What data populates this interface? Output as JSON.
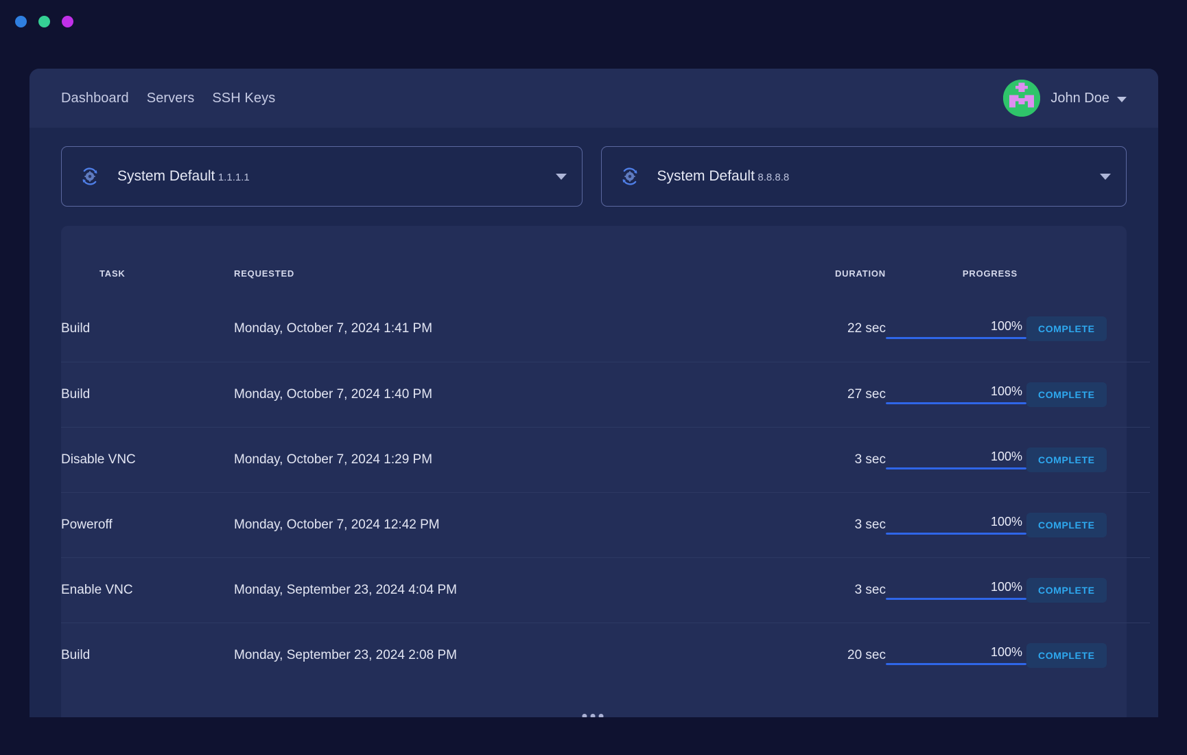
{
  "window": {
    "chrome_dots": [
      {
        "name": "close-dot",
        "color": "#2f7fe0"
      },
      {
        "name": "minimize-dot",
        "color": "#35d094"
      },
      {
        "name": "maximize-dot",
        "color": "#c030e8"
      }
    ]
  },
  "nav": {
    "links": [
      {
        "label": "Dashboard"
      },
      {
        "label": "Servers"
      },
      {
        "label": "SSH Keys"
      }
    ],
    "user": {
      "name": "John Doe",
      "avatar_bg": "#2fc46a",
      "avatar_fg": "#dd8ef0"
    }
  },
  "selectors": [
    {
      "icon": "gear-sync-icon",
      "title": "System Default",
      "subtitle": "1.1.1.1"
    },
    {
      "icon": "gear-sync-icon",
      "title": "System Default",
      "subtitle": "8.8.8.8"
    }
  ],
  "table": {
    "columns": [
      {
        "key": "task",
        "label": "TASK"
      },
      {
        "key": "requested",
        "label": "REQUESTED"
      },
      {
        "key": "duration",
        "label": "DURATION"
      },
      {
        "key": "progress",
        "label": "PROGRESS"
      },
      {
        "key": "status",
        "label": ""
      }
    ],
    "rows": [
      {
        "task": "Build",
        "requested": "Monday, October 7, 2024 1:41 PM",
        "duration": "22 sec",
        "progress_label": "100%",
        "progress_value": 100,
        "status": "COMPLETE"
      },
      {
        "task": "Build",
        "requested": "Monday, October 7, 2024 1:40 PM",
        "duration": "27 sec",
        "progress_label": "100%",
        "progress_value": 100,
        "status": "COMPLETE"
      },
      {
        "task": "Disable VNC",
        "requested": "Monday, October 7, 2024 1:29 PM",
        "duration": "3 sec",
        "progress_label": "100%",
        "progress_value": 100,
        "status": "COMPLETE"
      },
      {
        "task": "Poweroff",
        "requested": "Monday, October 7, 2024 12:42 PM",
        "duration": "3 sec",
        "progress_label": "100%",
        "progress_value": 100,
        "status": "COMPLETE"
      },
      {
        "task": "Enable VNC",
        "requested": "Monday, September 23, 2024 4:04 PM",
        "duration": "3 sec",
        "progress_label": "100%",
        "progress_value": 100,
        "status": "COMPLETE"
      },
      {
        "task": "Build",
        "requested": "Monday, September 23, 2024 2:08 PM",
        "duration": "20 sec",
        "progress_label": "100%",
        "progress_value": 100,
        "status": "COMPLETE"
      }
    ],
    "load_more_label": "•••"
  },
  "colors": {
    "page_bg": "#0f1230",
    "card_bg": "#1c274f",
    "panel_bg": "#232e58",
    "accent_blue": "#2f66e8",
    "badge_text": "#2ea9f0",
    "badge_bg": "#1f3a66",
    "border": "#5b68a0"
  }
}
